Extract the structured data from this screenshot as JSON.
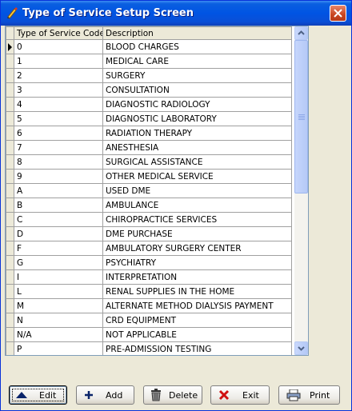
{
  "window": {
    "title": "Type of Service Setup Screen"
  },
  "grid": {
    "columns": [
      "Type of Service Code",
      "Description"
    ],
    "rows": [
      {
        "code": "0",
        "desc": "BLOOD CHARGES"
      },
      {
        "code": "1",
        "desc": "MEDICAL CARE"
      },
      {
        "code": "2",
        "desc": "SURGERY"
      },
      {
        "code": "3",
        "desc": "CONSULTATION"
      },
      {
        "code": "4",
        "desc": "DIAGNOSTIC RADIOLOGY"
      },
      {
        "code": "5",
        "desc": "DIAGNOSTIC LABORATORY"
      },
      {
        "code": "6",
        "desc": "RADIATION THERAPY"
      },
      {
        "code": "7",
        "desc": "ANESTHESIA"
      },
      {
        "code": "8",
        "desc": "SURGICAL ASSISTANCE"
      },
      {
        "code": "9",
        "desc": "OTHER MEDICAL SERVICE"
      },
      {
        "code": "A",
        "desc": "USED DME"
      },
      {
        "code": "B",
        "desc": "AMBULANCE"
      },
      {
        "code": "C",
        "desc": "CHIROPRACTICE SERVICES"
      },
      {
        "code": "D",
        "desc": "DME PURCHASE"
      },
      {
        "code": "F",
        "desc": "AMBULATORY SURGERY CENTER"
      },
      {
        "code": "G",
        "desc": "PSYCHIATRY"
      },
      {
        "code": "I",
        "desc": "INTERPRETATION"
      },
      {
        "code": "L",
        "desc": "RENAL SUPPLIES IN THE HOME"
      },
      {
        "code": "M",
        "desc": "ALTERNATE METHOD DIALYSIS PAYMENT"
      },
      {
        "code": "N",
        "desc": "CRD EQUIPMENT"
      },
      {
        "code": "N/A",
        "desc": "NOT APPLICABLE"
      },
      {
        "code": "P",
        "desc": "PRE-ADMISSION TESTING"
      }
    ]
  },
  "buttons": {
    "edit": {
      "label": "Edit",
      "icon": "up-triangle-icon"
    },
    "add": {
      "label": "Add",
      "icon": "plus-icon"
    },
    "delete": {
      "label": "Delete",
      "icon": "trash-icon"
    },
    "exit": {
      "label": "Exit",
      "icon": "red-x-icon"
    },
    "print": {
      "label": "Print",
      "icon": "printer-icon"
    }
  },
  "colors": {
    "titlebar": "#0054E3",
    "close": "#C8451F",
    "face": "#ECE9D8"
  }
}
